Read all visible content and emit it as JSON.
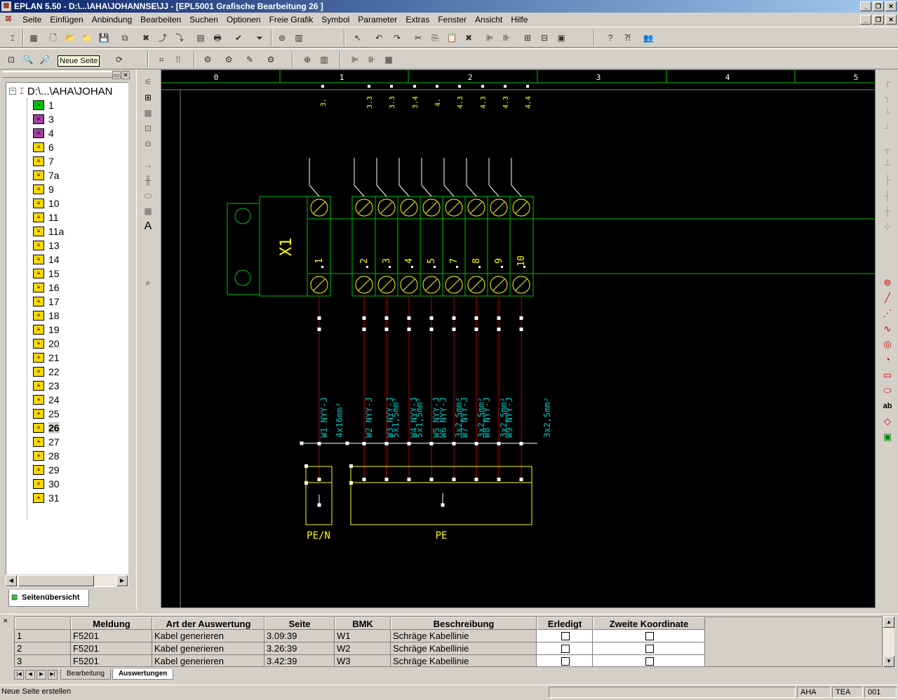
{
  "window": {
    "title": "EPLAN 5.50 - D:\\...\\AHA\\JOHANNSE\\JJ - [EPL5001 Grafische Bearbeitung 26  ]"
  },
  "menu": [
    "Seite",
    "Einfügen",
    "Anbindung",
    "Bearbeiten",
    "Suchen",
    "Optionen",
    "Freie Grafik",
    "Symbol",
    "Parameter",
    "Extras",
    "Fenster",
    "Ansicht",
    "Hilfe"
  ],
  "tooltip": "Neue Seite",
  "tree": {
    "root": "D:\\...\\AHA\\JOHAN",
    "pages": [
      {
        "label": "1",
        "icon": "green"
      },
      {
        "label": "3",
        "icon": "purple"
      },
      {
        "label": "4",
        "icon": "purple"
      },
      {
        "label": "6",
        "icon": "yellow"
      },
      {
        "label": "7",
        "icon": "yellow"
      },
      {
        "label": "7a",
        "icon": "yellow"
      },
      {
        "label": "9",
        "icon": "yellow"
      },
      {
        "label": "10",
        "icon": "yellow"
      },
      {
        "label": "11",
        "icon": "yellow"
      },
      {
        "label": "11a",
        "icon": "yellow"
      },
      {
        "label": "13",
        "icon": "yellow"
      },
      {
        "label": "14",
        "icon": "yellow"
      },
      {
        "label": "15",
        "icon": "yellow"
      },
      {
        "label": "16",
        "icon": "yellow"
      },
      {
        "label": "17",
        "icon": "yellow"
      },
      {
        "label": "18",
        "icon": "yellow"
      },
      {
        "label": "19",
        "icon": "yellow"
      },
      {
        "label": "20",
        "icon": "yellow"
      },
      {
        "label": "21",
        "icon": "yellow"
      },
      {
        "label": "22",
        "icon": "yellow"
      },
      {
        "label": "23",
        "icon": "yellow"
      },
      {
        "label": "24",
        "icon": "yellow"
      },
      {
        "label": "25",
        "icon": "yellow"
      },
      {
        "label": "26",
        "icon": "yellow",
        "selected": true
      },
      {
        "label": "27",
        "icon": "yellow"
      },
      {
        "label": "28",
        "icon": "yellow"
      },
      {
        "label": "29",
        "icon": "yellow"
      },
      {
        "label": "30",
        "icon": "yellow"
      },
      {
        "label": "31",
        "icon": "yellow"
      }
    ],
    "tab": "Seitenübersicht"
  },
  "drawing": {
    "columns": [
      "0",
      "1",
      "2",
      "3",
      "4",
      "5"
    ],
    "refs": [
      "3.",
      "3.3",
      "3.3",
      "3.4",
      "4.",
      "4.3",
      "4.3",
      "4.3",
      "4.4"
    ],
    "strip_label": "X1",
    "terminals": [
      "1",
      "2",
      "3",
      "4",
      "5",
      "7",
      "8",
      "9",
      "10"
    ],
    "cable_labels": [
      "W1 NYY-J",
      "4x16mm²",
      "W2 NYY-J",
      "W3 NYY-J",
      "5x1,5mm²",
      "W4 NYY-J",
      "5x1,5mm²",
      "W5 NYY-J",
      "W6 NYY-J",
      "3x2,5mm²",
      "W7 NYY-J",
      "3x2,5mm²",
      "W8 NYY-J",
      "3x2,5mm²",
      "W9 NYY-J",
      "3x2,5mm²"
    ],
    "box_labels": [
      "PE/N",
      "PE"
    ]
  },
  "messages": {
    "headers": [
      "Meldung",
      "Art der Auswertung",
      "Seite",
      "BMK",
      "Beschreibung",
      "Erledigt",
      "Zweite Koordinate"
    ],
    "rows": [
      {
        "n": "1",
        "meldung": "F5201",
        "art": "Kabel generieren",
        "seite": "3.09:39",
        "bmk": "W1",
        "beschreibung": "Schräge Kabellinie"
      },
      {
        "n": "2",
        "meldung": "F5201",
        "art": "Kabel generieren",
        "seite": "3.26:39",
        "bmk": "W2",
        "beschreibung": "Schräge Kabellinie"
      },
      {
        "n": "3",
        "meldung": "F5201",
        "art": "Kabel generieren",
        "seite": "3.42:39",
        "bmk": "W3",
        "beschreibung": "Schräge Kabellinie"
      }
    ],
    "tabs": [
      "Bearbeitung",
      "Auswertungen"
    ]
  },
  "status": {
    "text": "Neue Seite erstellen",
    "user": "AHA",
    "project": "TEA",
    "page": "001"
  },
  "colors": {
    "titlebar": "#0a246a",
    "canvas_bg": "#000000",
    "drawing_green": "#00c000",
    "drawing_yellow": "#ffff00",
    "drawing_cyan": "#00c0c0",
    "wire_red": "#c00000"
  }
}
